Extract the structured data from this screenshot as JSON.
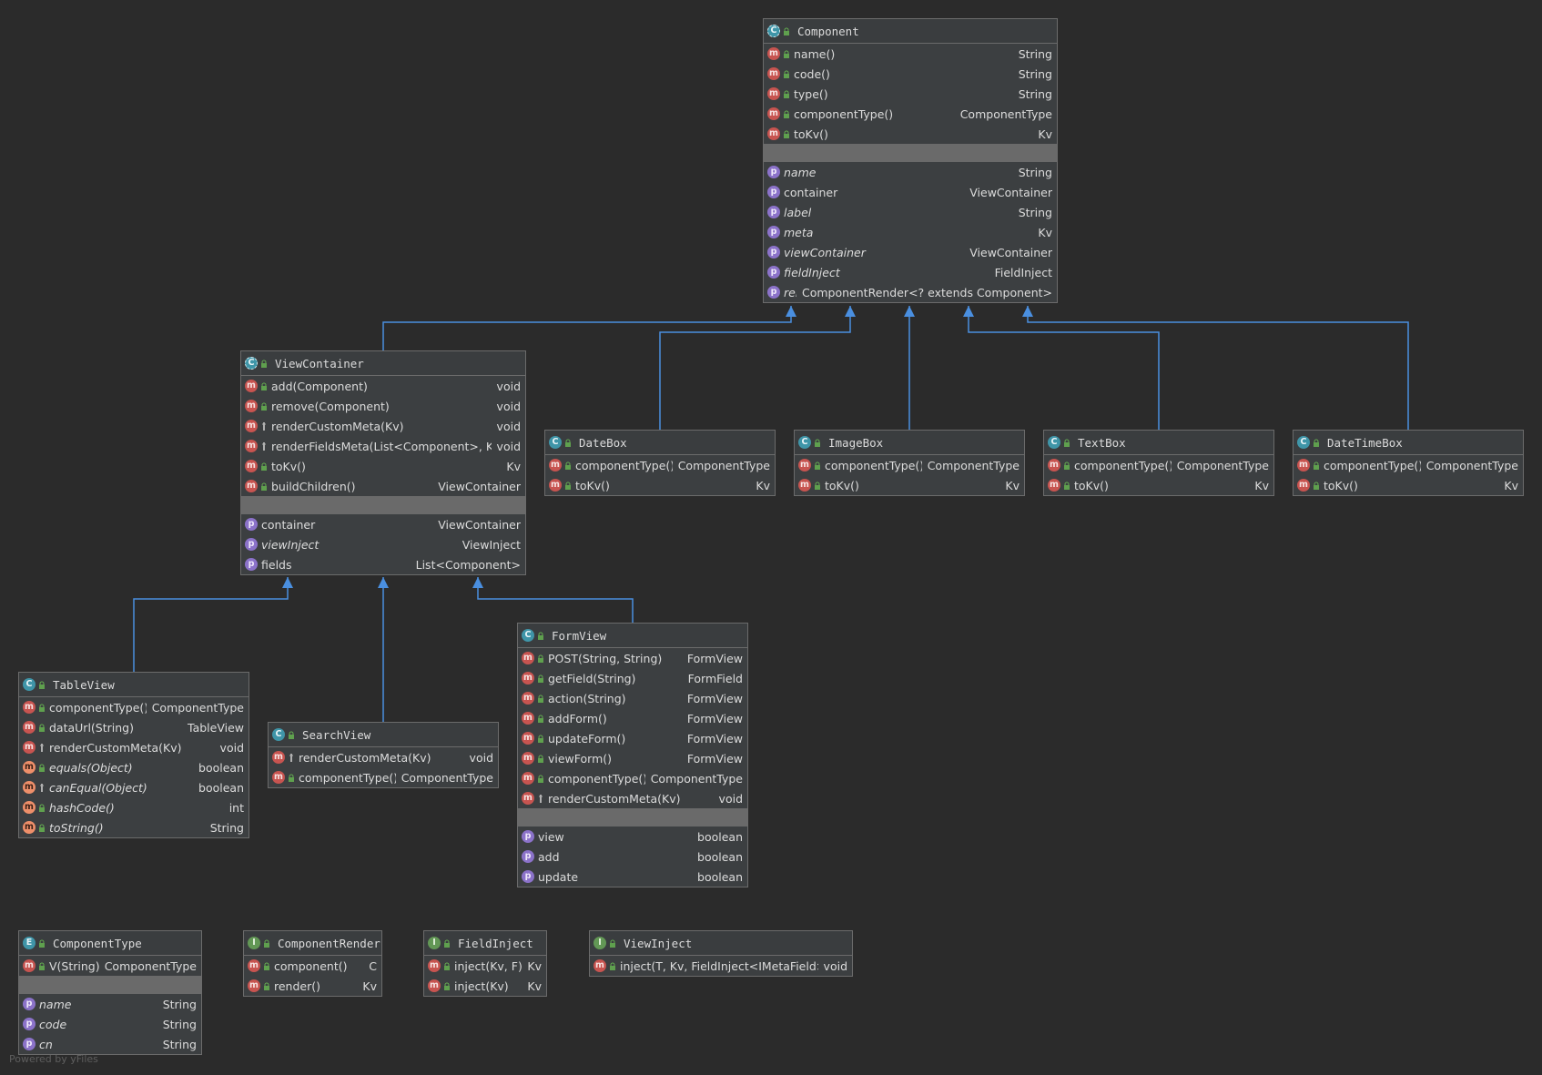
{
  "diagram": {
    "watermark": "Powered by yFiles",
    "nodes": [
      {
        "id": "component",
        "title": "Component",
        "kind": "abstract",
        "methods": [
          {
            "name": "name()",
            "type": "String",
            "vis": "public",
            "icon": "method"
          },
          {
            "name": "code()",
            "type": "String",
            "vis": "public",
            "icon": "method"
          },
          {
            "name": "type()",
            "type": "String",
            "vis": "public",
            "icon": "method"
          },
          {
            "name": "componentType()",
            "type": "ComponentType",
            "vis": "public",
            "icon": "method"
          },
          {
            "name": "toKv()",
            "type": "Kv",
            "vis": "public",
            "icon": "method"
          }
        ],
        "properties": [
          {
            "name": "name",
            "type": "String",
            "italic": true
          },
          {
            "name": "container",
            "type": "ViewContainer",
            "italic": false
          },
          {
            "name": "label",
            "type": "String",
            "italic": true
          },
          {
            "name": "meta",
            "type": "Kv",
            "italic": true
          },
          {
            "name": "viewContainer",
            "type": "ViewContainer",
            "italic": true
          },
          {
            "name": "fieldInject",
            "type": "FieldInject",
            "italic": true
          },
          {
            "name": "render",
            "type": "ComponentRender<? extends Component>",
            "italic": true
          }
        ]
      },
      {
        "id": "viewcontainer",
        "title": "ViewContainer",
        "kind": "abstract",
        "methods": [
          {
            "name": "add(Component)",
            "type": "void",
            "vis": "public",
            "icon": "method"
          },
          {
            "name": "remove(Component)",
            "type": "void",
            "vis": "public",
            "icon": "method"
          },
          {
            "name": "renderCustomMeta(Kv)",
            "type": "void",
            "vis": "protected",
            "icon": "method"
          },
          {
            "name": "renderFieldsMeta(List<Component>, Kv)",
            "type": "void",
            "vis": "protected",
            "icon": "method"
          },
          {
            "name": "toKv()",
            "type": "Kv",
            "vis": "public",
            "icon": "method"
          },
          {
            "name": "buildChildren()",
            "type": "ViewContainer",
            "vis": "public",
            "icon": "method"
          }
        ],
        "properties": [
          {
            "name": "container",
            "type": "ViewContainer",
            "italic": false
          },
          {
            "name": "viewInject",
            "type": "ViewInject",
            "italic": true
          },
          {
            "name": "fields",
            "type": "List<Component>",
            "italic": false
          }
        ]
      },
      {
        "id": "datebox",
        "title": "DateBox",
        "kind": "class",
        "methods": [
          {
            "name": "componentType()",
            "type": "ComponentType",
            "vis": "public",
            "icon": "method"
          },
          {
            "name": "toKv()",
            "type": "Kv",
            "vis": "public",
            "icon": "method"
          }
        ],
        "properties": []
      },
      {
        "id": "imagebox",
        "title": "ImageBox",
        "kind": "class",
        "methods": [
          {
            "name": "componentType()",
            "type": "ComponentType",
            "vis": "public",
            "icon": "method"
          },
          {
            "name": "toKv()",
            "type": "Kv",
            "vis": "public",
            "icon": "method"
          }
        ],
        "properties": []
      },
      {
        "id": "textbox",
        "title": "TextBox",
        "kind": "class",
        "methods": [
          {
            "name": "componentType()",
            "type": "ComponentType",
            "vis": "public",
            "icon": "method"
          },
          {
            "name": "toKv()",
            "type": "Kv",
            "vis": "public",
            "icon": "method"
          }
        ],
        "properties": []
      },
      {
        "id": "datetimebox",
        "title": "DateTimeBox",
        "kind": "class",
        "methods": [
          {
            "name": "componentType()",
            "type": "ComponentType",
            "vis": "public",
            "icon": "method"
          },
          {
            "name": "toKv()",
            "type": "Kv",
            "vis": "public",
            "icon": "method"
          }
        ],
        "properties": []
      },
      {
        "id": "formview",
        "title": "FormView",
        "kind": "class",
        "methods": [
          {
            "name": "POST(String, String)",
            "type": "FormView",
            "vis": "public",
            "icon": "static-method"
          },
          {
            "name": "getField(String)",
            "type": "FormField",
            "vis": "public",
            "icon": "method"
          },
          {
            "name": "action(String)",
            "type": "FormView",
            "vis": "public",
            "icon": "method"
          },
          {
            "name": "addForm()",
            "type": "FormView",
            "vis": "public",
            "icon": "method"
          },
          {
            "name": "updateForm()",
            "type": "FormView",
            "vis": "public",
            "icon": "method"
          },
          {
            "name": "viewForm()",
            "type": "FormView",
            "vis": "public",
            "icon": "method"
          },
          {
            "name": "componentType()",
            "type": "ComponentType",
            "vis": "public",
            "icon": "method"
          },
          {
            "name": "renderCustomMeta(Kv)",
            "type": "void",
            "vis": "protected",
            "icon": "method"
          }
        ],
        "properties": [
          {
            "name": "view",
            "type": "boolean",
            "italic": false
          },
          {
            "name": "add",
            "type": "boolean",
            "italic": false
          },
          {
            "name": "update",
            "type": "boolean",
            "italic": false
          }
        ]
      },
      {
        "id": "tableview",
        "title": "TableView",
        "kind": "class",
        "methods": [
          {
            "name": "componentType()",
            "type": "ComponentType",
            "vis": "public",
            "icon": "method"
          },
          {
            "name": "dataUrl(String)",
            "type": "TableView",
            "vis": "public",
            "icon": "method"
          },
          {
            "name": "renderCustomMeta(Kv)",
            "type": "void",
            "vis": "protected",
            "icon": "method"
          },
          {
            "name": "equals(Object)",
            "type": "boolean",
            "vis": "public",
            "icon": "override-method",
            "italic": true
          },
          {
            "name": "canEqual(Object)",
            "type": "boolean",
            "vis": "protected",
            "icon": "override-method",
            "italic": true
          },
          {
            "name": "hashCode()",
            "type": "int",
            "vis": "public",
            "icon": "override-method",
            "italic": true
          },
          {
            "name": "toString()",
            "type": "String",
            "vis": "public",
            "icon": "override-method",
            "italic": true
          }
        ],
        "properties": []
      },
      {
        "id": "searchview",
        "title": "SearchView",
        "kind": "class",
        "methods": [
          {
            "name": "renderCustomMeta(Kv)",
            "type": "void",
            "vis": "protected",
            "icon": "method"
          },
          {
            "name": "componentType()",
            "type": "ComponentType",
            "vis": "public",
            "icon": "method"
          }
        ],
        "properties": []
      },
      {
        "id": "componenttype",
        "title": "ComponentType",
        "kind": "enum",
        "methods": [
          {
            "name": "V(String)",
            "type": "ComponentType",
            "vis": "public",
            "icon": "static-method"
          }
        ],
        "properties": [
          {
            "name": "name",
            "type": "String",
            "italic": true
          },
          {
            "name": "code",
            "type": "String",
            "italic": true
          },
          {
            "name": "cn",
            "type": "String",
            "italic": true
          }
        ]
      },
      {
        "id": "componentrender",
        "title": "ComponentRender",
        "kind": "interface",
        "methods": [
          {
            "name": "component()",
            "type": "C",
            "vis": "public",
            "icon": "abstract-method"
          },
          {
            "name": "render()",
            "type": "Kv",
            "vis": "public",
            "icon": "abstract-method"
          }
        ],
        "properties": []
      },
      {
        "id": "fieldinject",
        "title": "FieldInject",
        "kind": "interface",
        "methods": [
          {
            "name": "inject(Kv, F)",
            "type": "Kv",
            "vis": "public",
            "icon": "abstract-method"
          },
          {
            "name": "inject(Kv)",
            "type": "Kv",
            "vis": "public",
            "icon": "abstract-method"
          }
        ],
        "properties": []
      },
      {
        "id": "viewinject",
        "title": "ViewInject",
        "kind": "interface",
        "methods": [
          {
            "name": "inject(T, Kv, FieldInject<IMetaField>)",
            "type": "void",
            "vis": "public",
            "icon": "abstract-method"
          }
        ],
        "properties": []
      }
    ],
    "edges": [
      {
        "from": "viewcontainer",
        "to": "component",
        "kind": "extends"
      },
      {
        "from": "datebox",
        "to": "component",
        "kind": "extends"
      },
      {
        "from": "imagebox",
        "to": "component",
        "kind": "extends"
      },
      {
        "from": "textbox",
        "to": "component",
        "kind": "extends"
      },
      {
        "from": "datetimebox",
        "to": "component",
        "kind": "extends"
      },
      {
        "from": "tableview",
        "to": "viewcontainer",
        "kind": "extends"
      },
      {
        "from": "searchview",
        "to": "viewcontainer",
        "kind": "extends"
      },
      {
        "from": "formview",
        "to": "viewcontainer",
        "kind": "extends"
      }
    ],
    "colors": {
      "background": "#2b2b2b",
      "node": "#3c3f41",
      "edge": "#4a8fe0",
      "separator": "#6a6a6a"
    }
  }
}
